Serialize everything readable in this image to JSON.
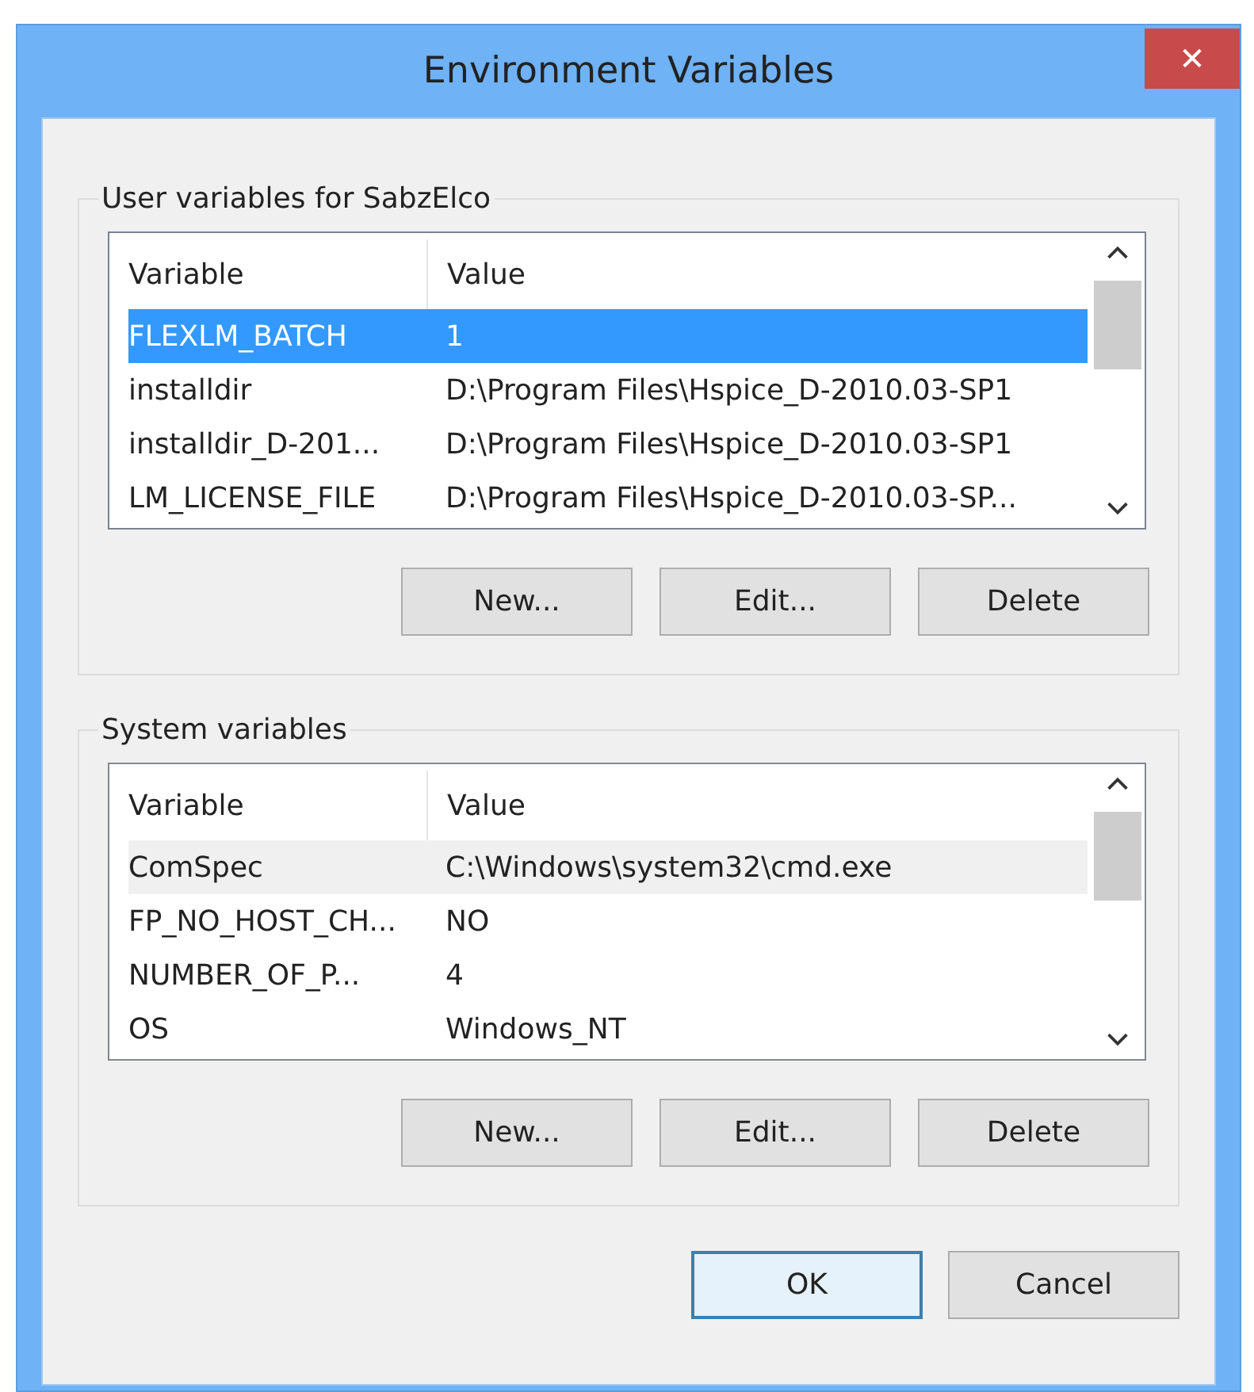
{
  "window": {
    "title": "Environment Variables",
    "close": "✕"
  },
  "groups": [
    {
      "title": "User variables for SabzElco",
      "focused": true,
      "columns": [
        "Variable",
        "Value"
      ],
      "rows": [
        {
          "cells": [
            "FLEXLM_BATCH",
            "1"
          ],
          "selected": true
        },
        {
          "cells": [
            "installdir",
            "D:\\Program Files\\Hspice_D-2010.03-SP1"
          ],
          "selected": false
        },
        {
          "cells": [
            "installdir_D-201...",
            "D:\\Program Files\\Hspice_D-2010.03-SP1"
          ],
          "selected": false
        },
        {
          "cells": [
            "LM_LICENSE_FILE",
            "D:\\Program Files\\Hspice_D-2010.03-SP..."
          ],
          "selected": false
        }
      ],
      "buttons": [
        "New...",
        "Edit...",
        "Delete"
      ]
    },
    {
      "title": "System variables",
      "focused": false,
      "columns": [
        "Variable",
        "Value"
      ],
      "rows": [
        {
          "cells": [
            "ComSpec",
            "C:\\Windows\\system32\\cmd.exe"
          ],
          "selected": true
        },
        {
          "cells": [
            "FP_NO_HOST_CH...",
            "NO"
          ],
          "selected": false
        },
        {
          "cells": [
            "NUMBER_OF_P...",
            "4"
          ],
          "selected": false
        },
        {
          "cells": [
            "OS",
            "Windows_NT"
          ],
          "selected": false
        }
      ],
      "buttons": [
        "New...",
        "Edit...",
        "Delete"
      ]
    }
  ],
  "buttons": [
    {
      "label": "OK",
      "default": true
    },
    {
      "label": "Cancel",
      "default": false
    }
  ]
}
